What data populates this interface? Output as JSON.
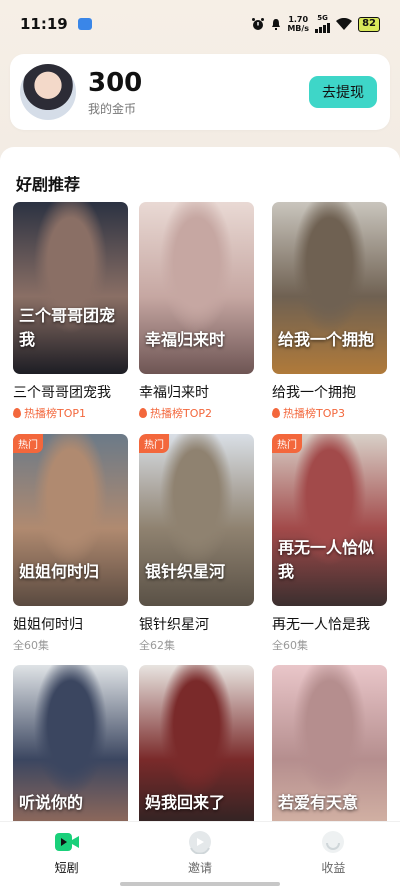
{
  "status_bar": {
    "time": "11:19",
    "net_speed_top": "1.70",
    "net_speed_unit": "MB/s",
    "network": "5G",
    "battery": "82"
  },
  "wallet": {
    "coins": "300",
    "coins_label": "我的金币",
    "withdraw_label": "去提现"
  },
  "section_title": "好剧推荐",
  "dramas": [
    {
      "title": "三个哥哥团宠我",
      "sub": "热播榜TOP1",
      "hot_rank": true,
      "badge": "",
      "poster_text": "三个哥哥团宠我",
      "colors": [
        "#2b3242",
        "#8a6f65",
        "#1d1d24"
      ]
    },
    {
      "title": "幸福归来时",
      "sub": "热播榜TOP2",
      "hot_rank": true,
      "badge": "",
      "poster_text": "幸福归来时",
      "colors": [
        "#e9d9d4",
        "#c6a7a2",
        "#6e5554"
      ]
    },
    {
      "title": "给我一个拥抱",
      "sub": "热播榜TOP3",
      "hot_rank": true,
      "badge": "",
      "poster_text": "给我一个拥抱",
      "colors": [
        "#c9c5bd",
        "#6f6152",
        "#b07a3a"
      ]
    },
    {
      "title": "姐姐何时归",
      "sub": "全60集",
      "hot_rank": false,
      "badge": "热门",
      "poster_text": "姐姐何时归",
      "colors": [
        "#6b7a88",
        "#b08a70",
        "#5a4a40"
      ]
    },
    {
      "title": "银针织星河",
      "sub": "全62集",
      "hot_rank": false,
      "badge": "热门",
      "poster_text": "银针织星河",
      "colors": [
        "#d9dfe6",
        "#8f8270",
        "#5a5146"
      ]
    },
    {
      "title": "再无一人恰是我",
      "sub": "全60集",
      "hot_rank": false,
      "badge": "热门",
      "poster_text": "再无一人恰似我",
      "colors": [
        "#d8d0c8",
        "#a24a4a",
        "#3b2f2f"
      ]
    },
    {
      "title": "",
      "sub": "",
      "hot_rank": false,
      "badge": "",
      "poster_text": "听说你的",
      "colors": [
        "#dfe3e6",
        "#3b4660",
        "#a0705a"
      ]
    },
    {
      "title": "",
      "sub": "",
      "hot_rank": false,
      "badge": "",
      "poster_text": "妈我回来了",
      "colors": [
        "#e8e4e0",
        "#7a2a2a",
        "#222"
      ]
    },
    {
      "title": "",
      "sub": "",
      "hot_rank": false,
      "badge": "",
      "poster_text": "若爱有天意",
      "colors": [
        "#e9c6c9",
        "#b58e8e",
        "#d8b8a8"
      ]
    }
  ],
  "nav": [
    {
      "label": "短剧",
      "icon": "video-icon",
      "active": true
    },
    {
      "label": "邀请",
      "icon": "invite-icon",
      "active": false
    },
    {
      "label": "收益",
      "icon": "earnings-icon",
      "active": false
    }
  ],
  "colors": {
    "accent": "#3ed6c8",
    "hot": "#f3673c",
    "nav_active": "#1ad07a"
  }
}
